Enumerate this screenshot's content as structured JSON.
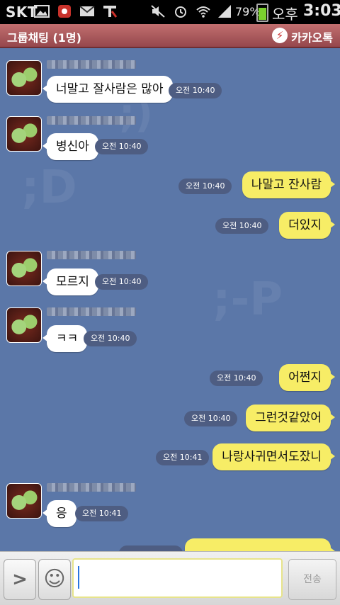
{
  "status_bar": {
    "carrier": "SKT",
    "battery_text": "79%",
    "battery_level": 0.79,
    "ampm": "오후",
    "time": "3:03",
    "icons": [
      "gallery-icon",
      "app-notification-icon",
      "mail-icon",
      "tmap-icon",
      "mute-icon",
      "alarm-icon",
      "wifi-icon",
      "signal-icon",
      "battery-icon"
    ]
  },
  "title_bar": {
    "title": "그룹채팅 (1명)",
    "brand": "카카오톡"
  },
  "watermarks": [
    ";)",
    ";D",
    ";-P"
  ],
  "messages": [
    {
      "dir": "in",
      "text": "너말고 잘사람은 많아",
      "time": "오전 10:40"
    },
    {
      "dir": "in",
      "text": "병신아",
      "time": "오전 10:40"
    },
    {
      "dir": "out",
      "text": "나말고 잔사람",
      "time": "오전 10:40"
    },
    {
      "dir": "out",
      "text": "더있지",
      "time": "오전 10:40"
    },
    {
      "dir": "in",
      "text": "모르지",
      "time": "오전 10:40"
    },
    {
      "dir": "in",
      "text": "ㅋㅋ",
      "time": "오전 10:40"
    },
    {
      "dir": "out",
      "text": "어쩐지",
      "time": "오전 10:40"
    },
    {
      "dir": "out",
      "text": "그런것같았어",
      "time": "오전 10:40"
    },
    {
      "dir": "out",
      "text": "나랑사귀면서도잤니",
      "time": "오전 10:41"
    },
    {
      "dir": "in",
      "text": "응",
      "time": "오전 10:41"
    }
  ],
  "input_bar": {
    "input_value": "",
    "send_label": "전송",
    "more_glyph": ">",
    "emoticon_glyph": "☺"
  },
  "colors": {
    "chat_background": "#5b77a8",
    "title_bar": "#a9595c",
    "outgoing_bubble": "#f7ed66",
    "incoming_bubble": "#ffffff"
  }
}
